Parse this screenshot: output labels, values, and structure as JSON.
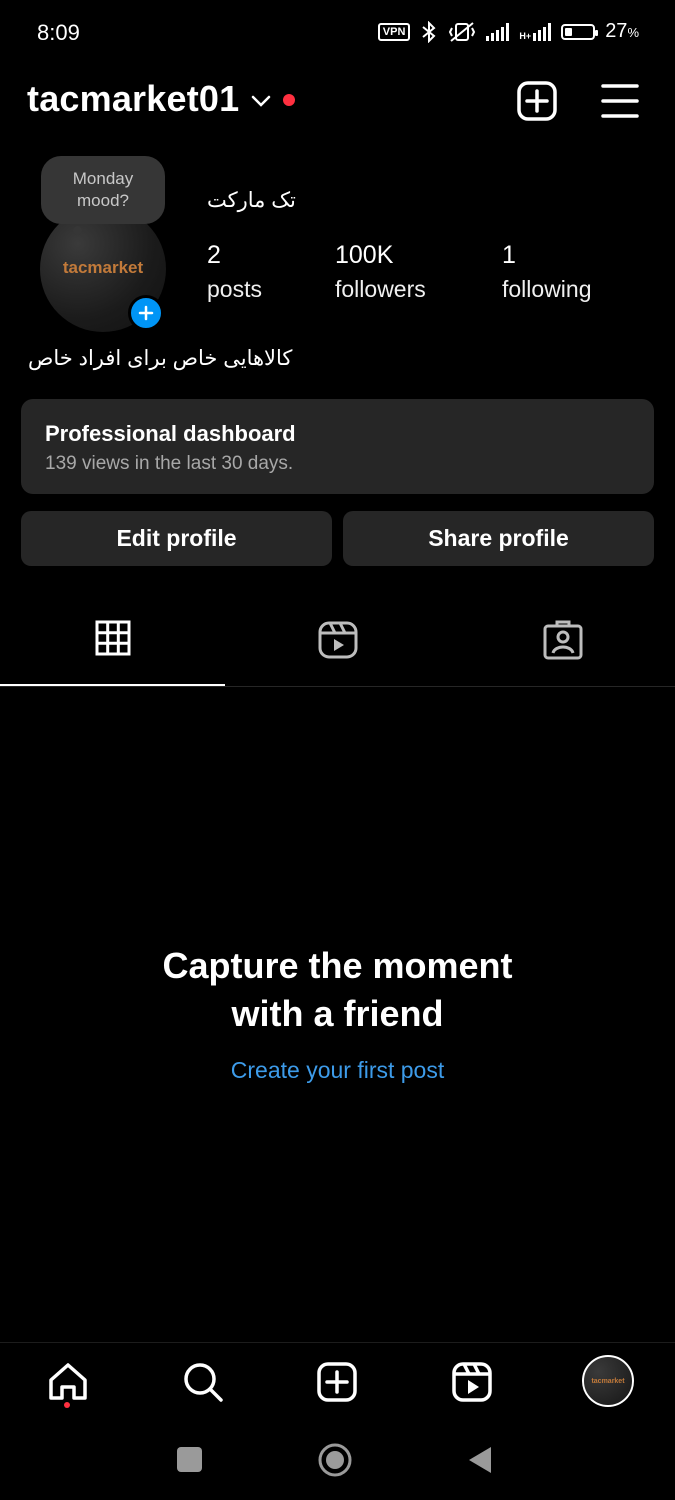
{
  "status_bar": {
    "time": "8:09",
    "vpn": "VPN",
    "network": "H+",
    "battery_percent": "27",
    "battery_unit": "%",
    "battery_level": 0.27
  },
  "header": {
    "username": "tacmarket01",
    "icons": [
      "chevron-down-icon",
      "new-post-icon",
      "menu-icon"
    ]
  },
  "profile": {
    "note": "Monday mood?",
    "avatar_text": "tacmarket",
    "display_name": "تک مارکت",
    "stats": [
      {
        "value": "2",
        "label": "posts"
      },
      {
        "value": "100K",
        "label": "followers"
      },
      {
        "value": "1",
        "label": "following"
      }
    ],
    "bio": "کالاهایی خاص برای افراد خاص"
  },
  "dashboard": {
    "title": "Professional dashboard",
    "subtitle": "139 views in the last 30 days."
  },
  "buttons": {
    "edit": "Edit profile",
    "share": "Share profile"
  },
  "tabs": [
    "grid-icon",
    "reels-icon",
    "tagged-icon"
  ],
  "empty_state": {
    "title_line1": "Capture the moment",
    "title_line2": "with a friend",
    "link": "Create your first post"
  },
  "bottom_nav": {
    "items": [
      "home-icon",
      "search-icon",
      "create-icon",
      "reels-icon",
      "profile-avatar"
    ],
    "avatar_text": "tacmarket"
  },
  "colors": {
    "accent": "#0095f6",
    "link": "#3d9be9",
    "notification": "#ff3040",
    "surface": "#262626"
  }
}
